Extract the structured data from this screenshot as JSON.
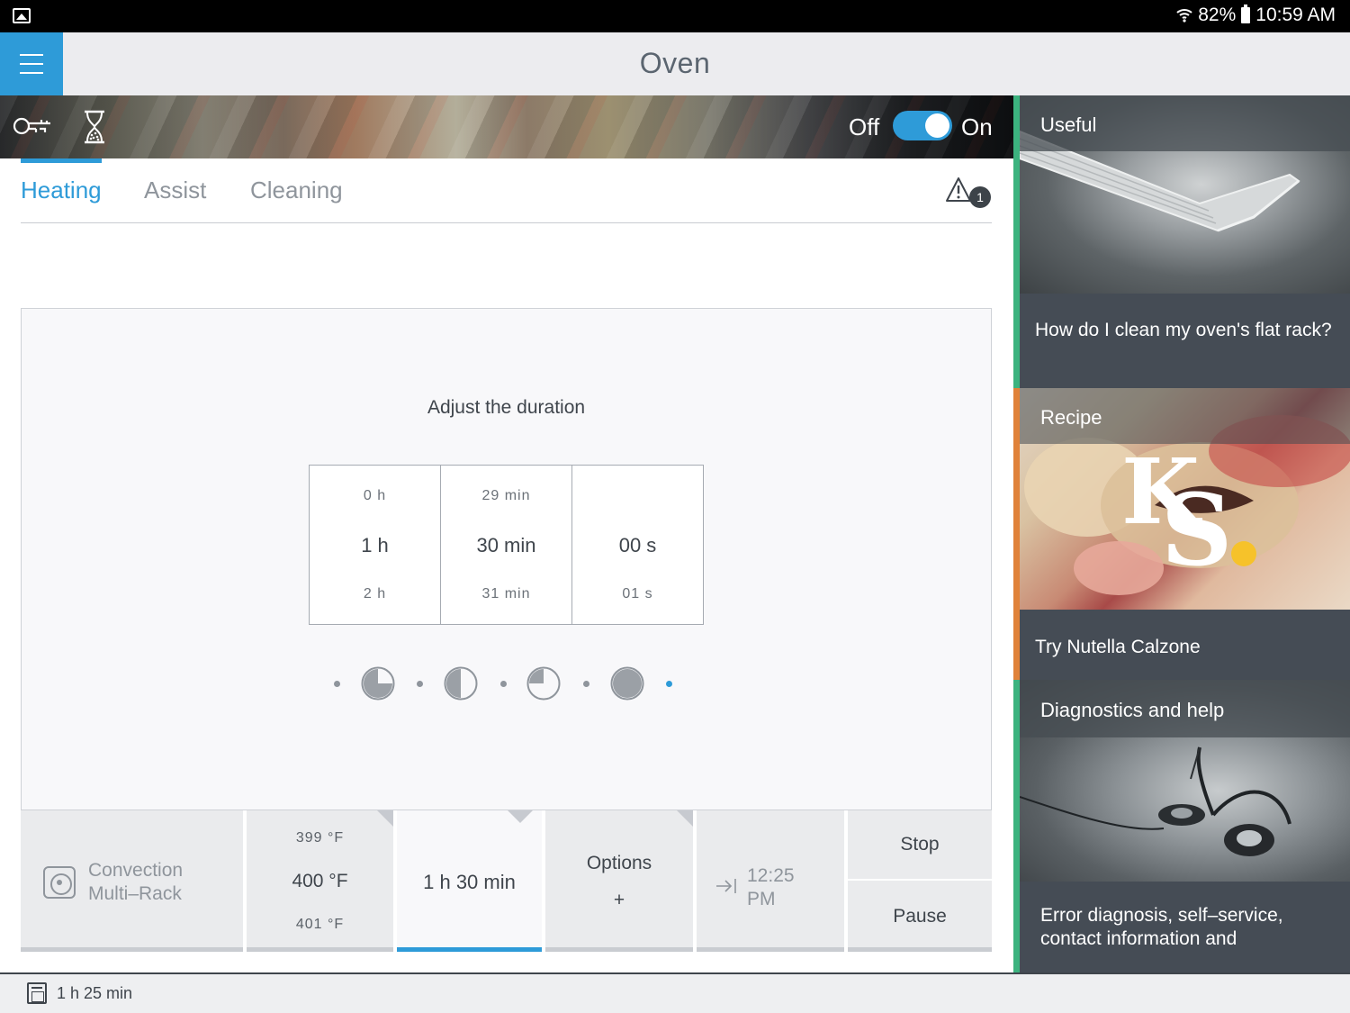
{
  "status_bar": {
    "battery": "82%",
    "time": "10:59 AM"
  },
  "app_bar": {
    "title": "Oven"
  },
  "banner": {
    "toggle_off_label": "Off",
    "toggle_on_label": "On",
    "power_on": true
  },
  "tabs": [
    {
      "label": "Heating",
      "active": true
    },
    {
      "label": "Assist",
      "active": false
    },
    {
      "label": "Cleaning",
      "active": false
    }
  ],
  "warning_count": "1",
  "duration_panel": {
    "title": "Adjust the duration",
    "picker": [
      {
        "prev": "0 h",
        "current": "1 h",
        "next": "2 h"
      },
      {
        "prev": "29 min",
        "current": "30 min",
        "next": "31 min"
      },
      {
        "prev": "",
        "current": "00 s",
        "next": "01 s"
      }
    ],
    "preset_fractions": [
      0.25,
      0.5,
      0.75,
      1.0
    ]
  },
  "controls": {
    "mode_line1": "Convection",
    "mode_line2": "Multi–Rack",
    "temp_prev": "399 °F",
    "temp_current": "400 °F",
    "temp_next": "401 °F",
    "duration": "1 h 30 min",
    "options_label": "Options",
    "options_plus": "+",
    "end_time_line1": "12:25",
    "end_time_line2": "PM",
    "stop_label": "Stop",
    "pause_label": "Pause"
  },
  "side_cards": {
    "useful": {
      "title": "Useful",
      "caption": "How do I clean my oven's flat rack?"
    },
    "recipe": {
      "title": "Recipe",
      "caption": "Try Nutella Calzone",
      "logo_text": "KS"
    },
    "diagnostics": {
      "title": "Diagnostics and help",
      "caption": "Error diagnosis, self–service, contact information and"
    }
  },
  "footer": {
    "remaining": "1 h 25 min"
  },
  "colors": {
    "accent": "#2e9bd8",
    "useful_accent": "#3cb37f",
    "recipe_accent": "#e0823a"
  }
}
